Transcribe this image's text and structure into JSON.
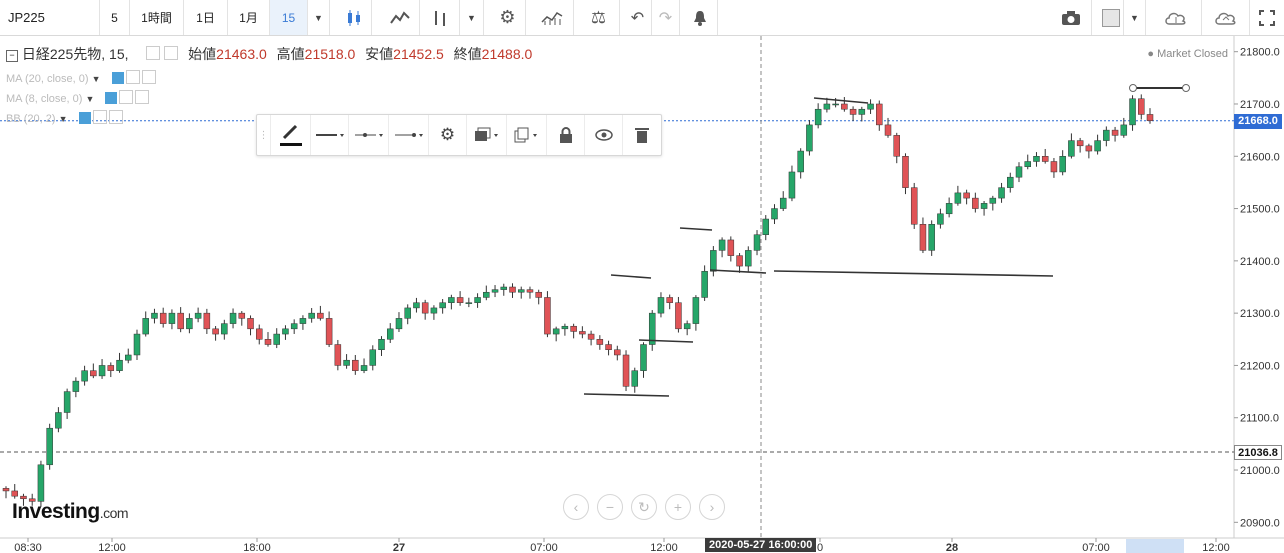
{
  "toolbar": {
    "symbol": "JP225",
    "interval_5": "5",
    "interval_1h": "1時間",
    "interval_1d": "1日",
    "interval_1m": "1月",
    "interval_15": "15"
  },
  "legend": {
    "name": "日経225先物, 15,",
    "open_label": "始値",
    "open_value": "21463.0",
    "high_label": "高値",
    "high_value": "21518.0",
    "low_label": "安値",
    "low_value": "21452.5",
    "close_label": "終値",
    "close_value": "21488.0"
  },
  "indicators": [
    {
      "label": "MA (20, close, 0)"
    },
    {
      "label": "MA (8, close, 0)"
    },
    {
      "label": "BB (20, 2)"
    }
  ],
  "market_status": "Market Closed",
  "price_tags": {
    "current": "21668.0",
    "reference": "21036.8"
  },
  "crosshair_time": "2020-05-27 16:00:00",
  "logo": {
    "main": "Investing",
    "suffix": ".com"
  },
  "colors": {
    "up": "#26a669",
    "down": "#e05356",
    "current": "#2f6cd4",
    "reference": "#3d3d3d"
  },
  "chart_data": {
    "type": "candlestick",
    "ylim": [
      20870,
      21830
    ],
    "y_ticks": [
      20900,
      21000,
      21100,
      21200,
      21300,
      21400,
      21500,
      21600,
      21700,
      21800
    ],
    "y_tick_labels": [
      "20900.0",
      "21000.0",
      "21100.0",
      "21200.0",
      "21300.0",
      "21400.0",
      "21500.0",
      "21600.0",
      "21700.0",
      "21800.0"
    ],
    "x_tick_labels": [
      "08:30",
      "12:00",
      "18:00",
      "27",
      "07:00",
      "12:00",
      "0",
      "28",
      "07:00",
      "12:00"
    ],
    "close_series": [
      20960,
      20950,
      20945,
      20940,
      21010,
      21080,
      21110,
      21150,
      21170,
      21190,
      21180,
      21200,
      21190,
      21210,
      21220,
      21260,
      21290,
      21300,
      21280,
      21300,
      21270,
      21290,
      21300,
      21270,
      21260,
      21280,
      21300,
      21290,
      21270,
      21250,
      21240,
      21260,
      21270,
      21280,
      21290,
      21300,
      21290,
      21240,
      21200,
      21210,
      21190,
      21200,
      21230,
      21250,
      21270,
      21290,
      21310,
      21320,
      21300,
      21310,
      21320,
      21330,
      21320,
      21320,
      21330,
      21340,
      21345,
      21350,
      21340,
      21345,
      21340,
      21330,
      21260,
      21270,
      21275,
      21265,
      21260,
      21250,
      21240,
      21230,
      21220,
      21160,
      21190,
      21240,
      21300,
      21330,
      21320,
      21270,
      21280,
      21330,
      21380,
      21420,
      21440,
      21410,
      21390,
      21420,
      21450,
      21480,
      21500,
      21520,
      21570,
      21610,
      21660,
      21690,
      21700,
      21700,
      21690,
      21680,
      21690,
      21700,
      21660,
      21640,
      21600,
      21540,
      21470,
      21420,
      21470,
      21490,
      21510,
      21530,
      21520,
      21500,
      21510,
      21520,
      21540,
      21560,
      21580,
      21590,
      21600,
      21590,
      21570,
      21600,
      21630,
      21620,
      21610,
      21630,
      21650,
      21640,
      21660,
      21710,
      21680,
      21668
    ],
    "high": 21518.0,
    "low": 21452.5,
    "open": 21463.0,
    "close": 21488.0
  }
}
